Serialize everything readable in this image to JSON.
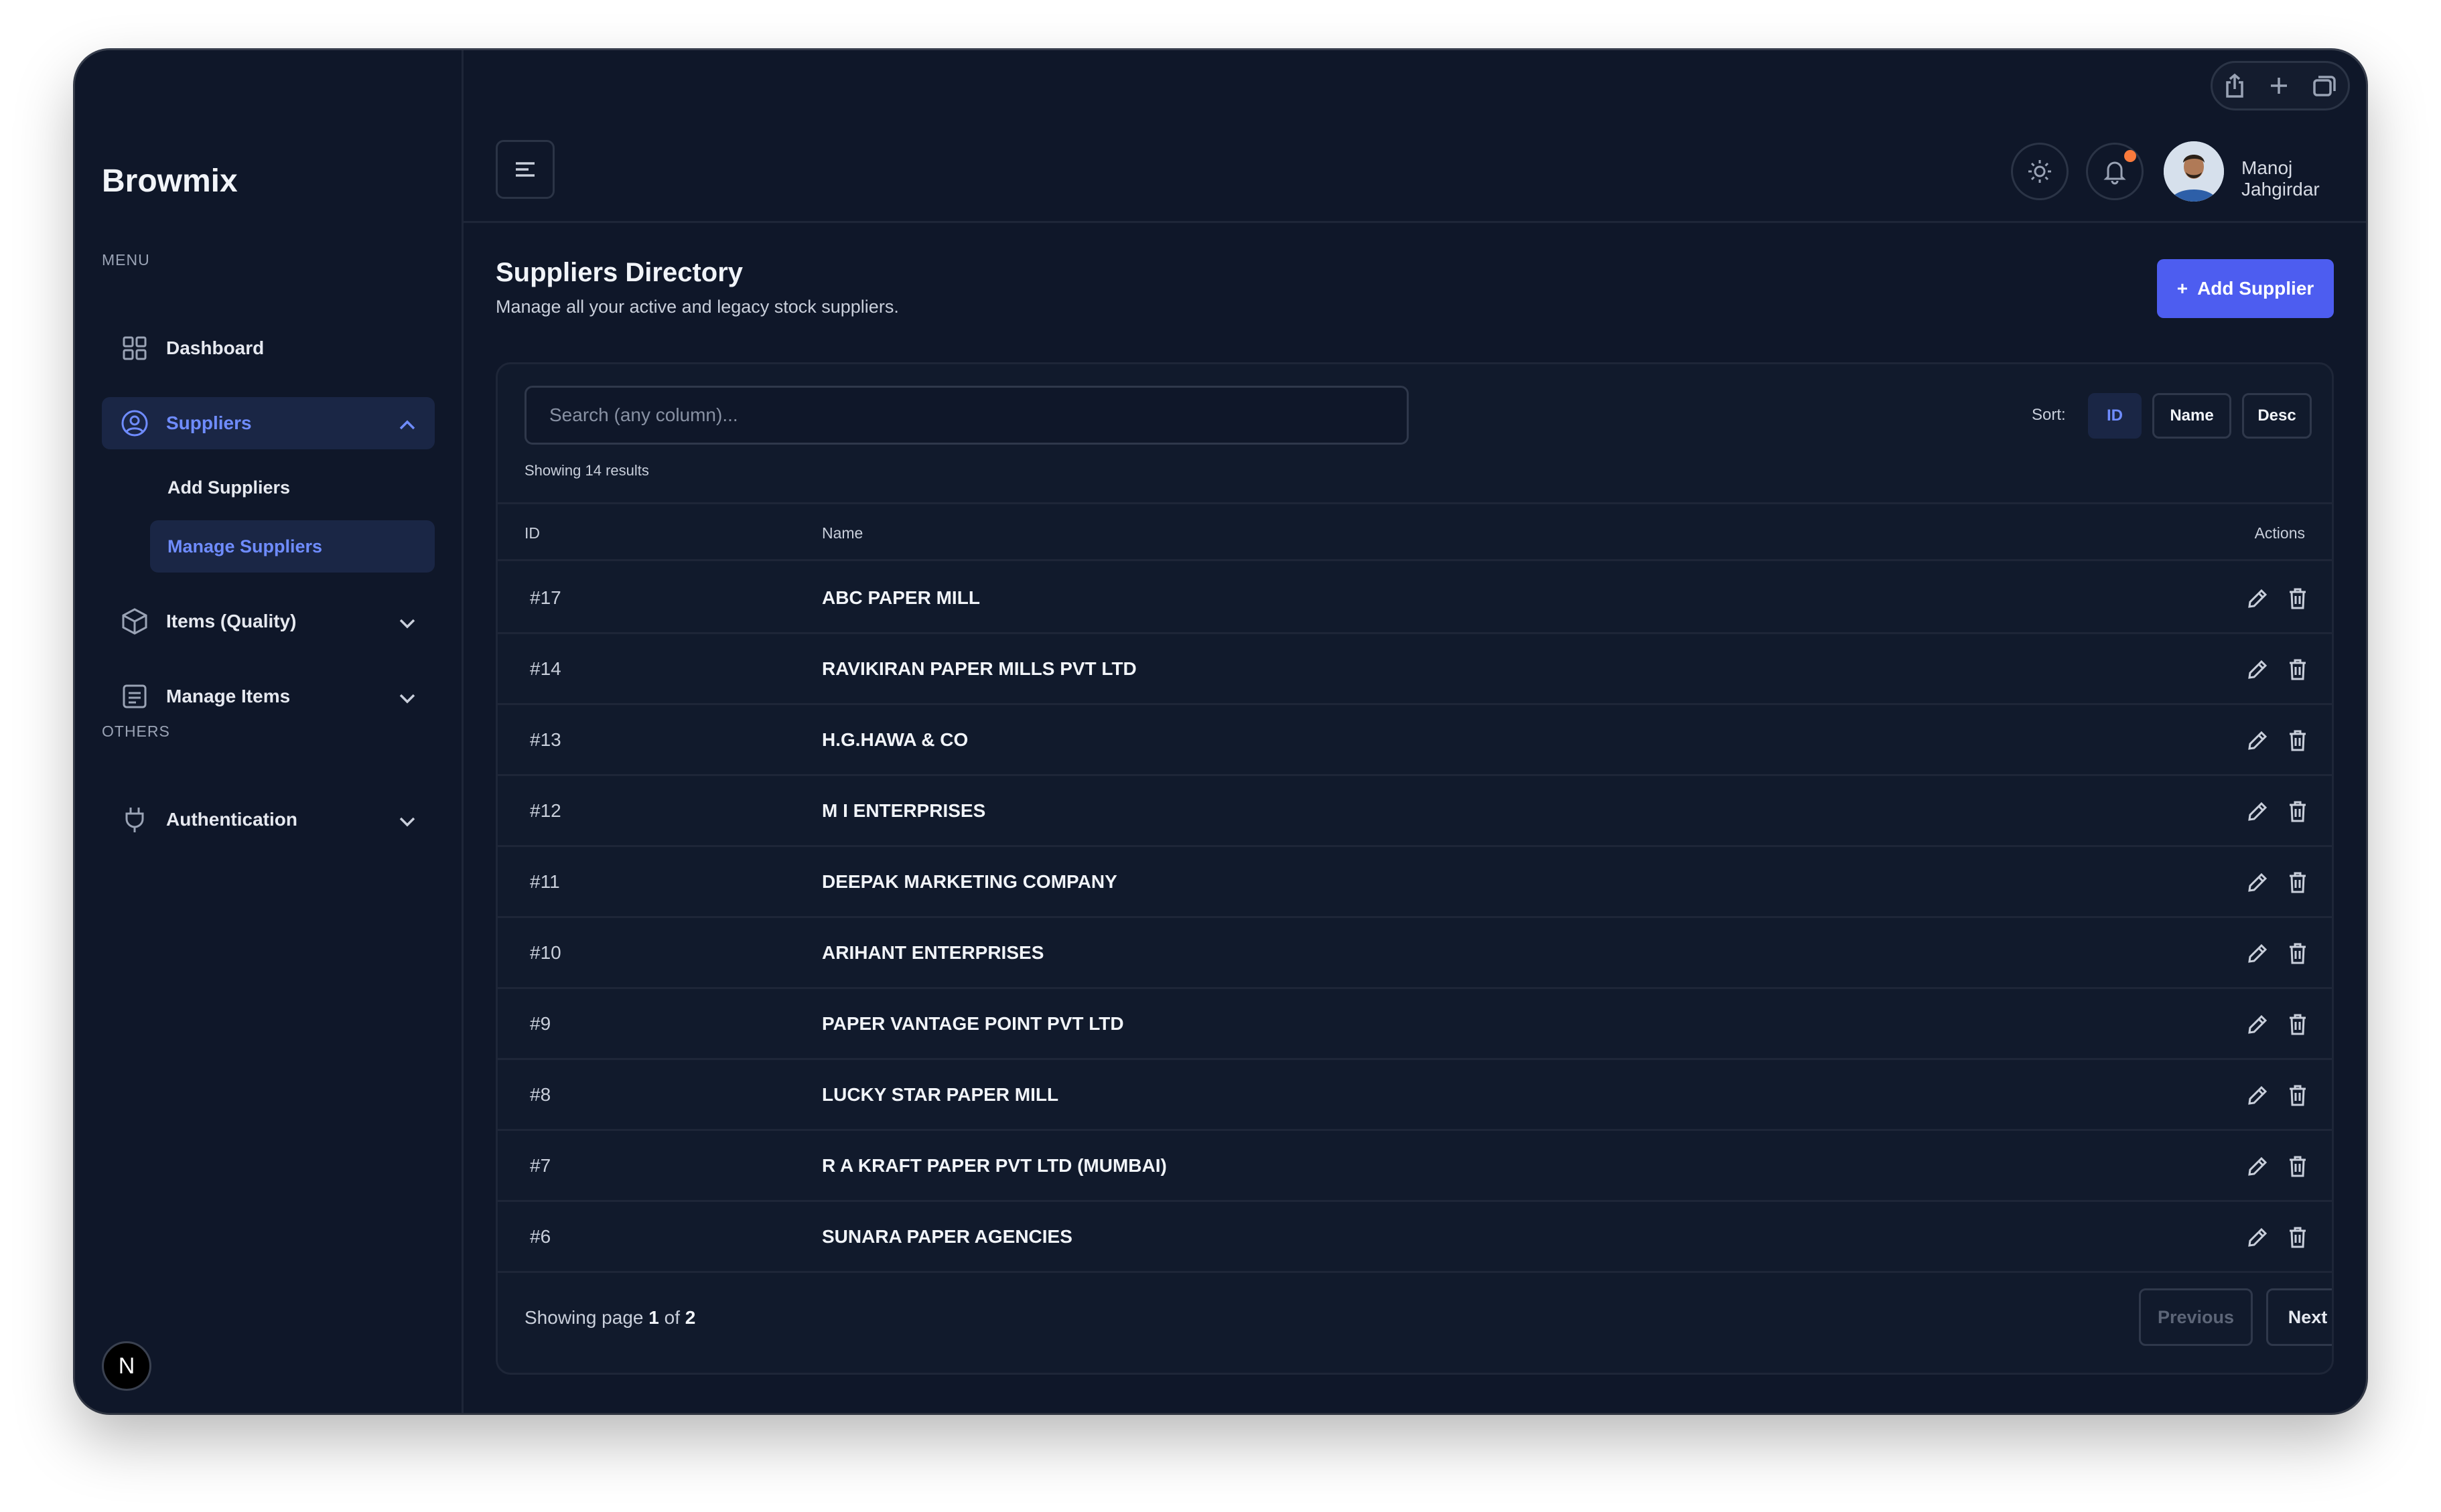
{
  "colors": {
    "window_bg": "#0f1729",
    "accent": "#4d5df0",
    "active_text": "#6f8cff",
    "active_bg": "#1a2645",
    "notification": "#f97a3c"
  },
  "browser": {
    "traffic_lights": [
      "#ff5f57",
      "#febc2e",
      "#28c840"
    ]
  },
  "sidebar": {
    "brand": "Browmix",
    "menu_title": "MENU",
    "others_title": "OTHERS",
    "items": {
      "dashboard": "Dashboard",
      "suppliers": "Suppliers",
      "add_suppliers": "Add Suppliers",
      "manage_suppliers": "Manage Suppliers",
      "items_quality": "Items (Quality)",
      "manage_items": "Manage Items",
      "authentication": "Authentication"
    },
    "badge": "N"
  },
  "header": {
    "user_name": "Manoj Jahgirdar"
  },
  "page": {
    "title": "Suppliers Directory",
    "subtitle": "Manage all your active and legacy stock suppliers.",
    "add_button": "Add Supplier",
    "add_icon": "+"
  },
  "toolbar": {
    "search_placeholder": "Search (any column)...",
    "sort_label": "Sort:",
    "sort_id": "ID",
    "sort_name": "Name",
    "sort_desc": "Desc",
    "results": "Showing 14 results"
  },
  "table": {
    "columns": {
      "id": "ID",
      "name": "Name",
      "actions": "Actions"
    },
    "rows": [
      {
        "id": "#17",
        "name": "ABC PAPER MILL"
      },
      {
        "id": "#14",
        "name": "RAVIKIRAN PAPER MILLS PVT LTD"
      },
      {
        "id": "#13",
        "name": "H.G.HAWA & CO"
      },
      {
        "id": "#12",
        "name": "M I ENTERPRISES"
      },
      {
        "id": "#11",
        "name": "DEEPAK MARKETING COMPANY"
      },
      {
        "id": "#10",
        "name": "ARIHANT ENTERPRISES"
      },
      {
        "id": "#9",
        "name": "PAPER VANTAGE POINT PVT LTD"
      },
      {
        "id": "#8",
        "name": "LUCKY STAR PAPER MILL"
      },
      {
        "id": "#7",
        "name": "R A KRAFT PAPER PVT LTD (MUMBAI)"
      },
      {
        "id": "#6",
        "name": "SUNARA PAPER AGENCIES"
      }
    ]
  },
  "pagination": {
    "prefix": "Showing page",
    "current": "1",
    "of": "of",
    "total": "2",
    "previous": "Previous",
    "next": "Next"
  }
}
